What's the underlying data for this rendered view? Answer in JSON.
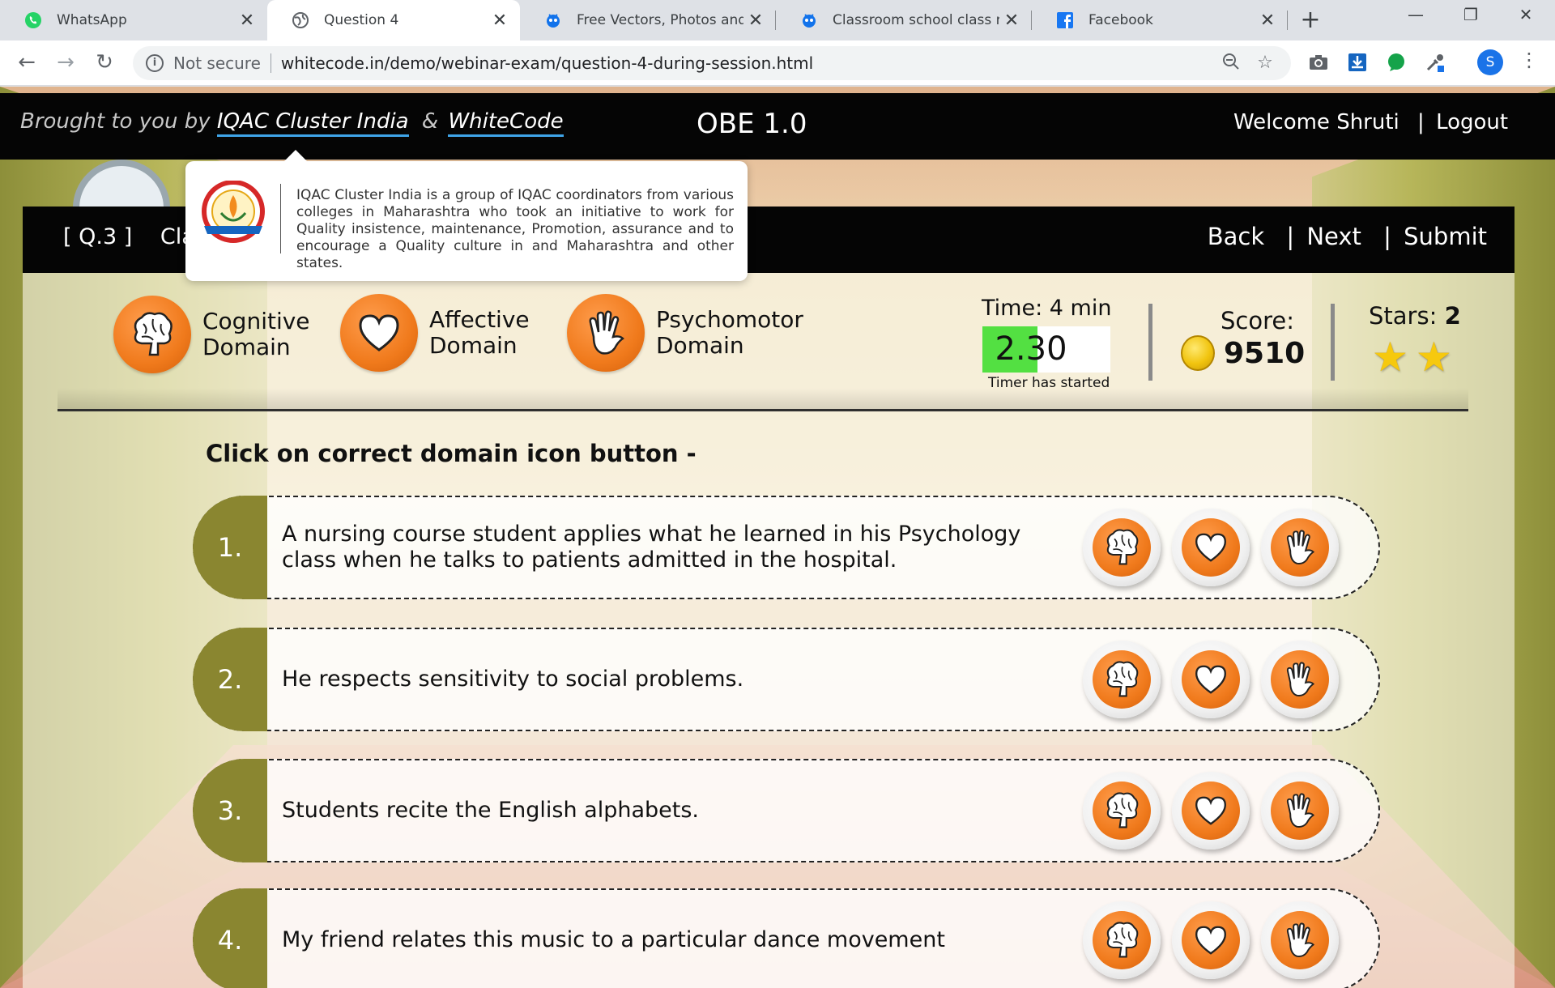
{
  "browser": {
    "tabs": [
      {
        "title": "WhatsApp",
        "icon": "whatsapp-icon"
      },
      {
        "title": "Question 4",
        "icon": "globe-icon"
      },
      {
        "title": "Free Vectors, Photos and PSD",
        "icon": "freepik-icon"
      },
      {
        "title": "Classroom school class room",
        "icon": "freepik-icon"
      },
      {
        "title": "Facebook",
        "icon": "facebook-icon"
      }
    ],
    "security_label": "Not secure",
    "url": "whitecode.in/demo/webinar-exam/question-4-during-session.html",
    "profile_initial": "S"
  },
  "header": {
    "brought_prefix": "Brought to you by",
    "link1": "IQAC Cluster India",
    "amp": "&",
    "link2": "WhiteCode",
    "app_title": "OBE 1.0",
    "welcome": "Welcome Shruti",
    "sep": "|",
    "logout": "Logout"
  },
  "tooltip": {
    "text": "IQAC Cluster India is a group of IQAC coordinators from various colleges in Maharashtra who took an initiative to work for Quality insistence, maintenance, Promotion, assurance and to encourage a Quality culture in and Maharashtra and other states.",
    "logo_text": "IQAC CLUSTER INDIA",
    "logo_tagline": "Not Competition But Cooperation"
  },
  "question_bar": {
    "number": "[ Q.3 ]",
    "title_partial": "Cla",
    "back": "Back",
    "next": "Next",
    "submit": "Submit",
    "sep": "|"
  },
  "domains": [
    {
      "line1": "Cognitive",
      "line2": "Domain",
      "icon": "brain-icon"
    },
    {
      "line1": "Affective",
      "line2": "Domain",
      "icon": "heart-icon"
    },
    {
      "line1": "Psychomotor",
      "line2": "Domain",
      "icon": "hand-icon"
    }
  ],
  "timer": {
    "label": "Time:  4 min",
    "value": "2.30",
    "progress": 0.43,
    "note": "Timer has started",
    "fill_color": "#53e042"
  },
  "score": {
    "label": "Score:",
    "value": "9510"
  },
  "stars": {
    "label": "Stars:",
    "value": "2",
    "count": 2
  },
  "instruction": "Click on correct domain icon button -",
  "questions": [
    {
      "num": "1.",
      "text": "A nursing course student applies what he learned in his Psychology class when he talks to patients admitted in the hospital."
    },
    {
      "num": "2.",
      "text": "He respects sensitivity to social problems."
    },
    {
      "num": "3.",
      "text": "Students recite the English alphabets."
    },
    {
      "num": "4.",
      "text": "My friend relates this music to a particular dance movement"
    }
  ],
  "colors": {
    "accent_orange": "#f07a1c",
    "number_olive": "#8a8630",
    "bar_black": "#050505",
    "link_underline": "#3fa4e8"
  }
}
